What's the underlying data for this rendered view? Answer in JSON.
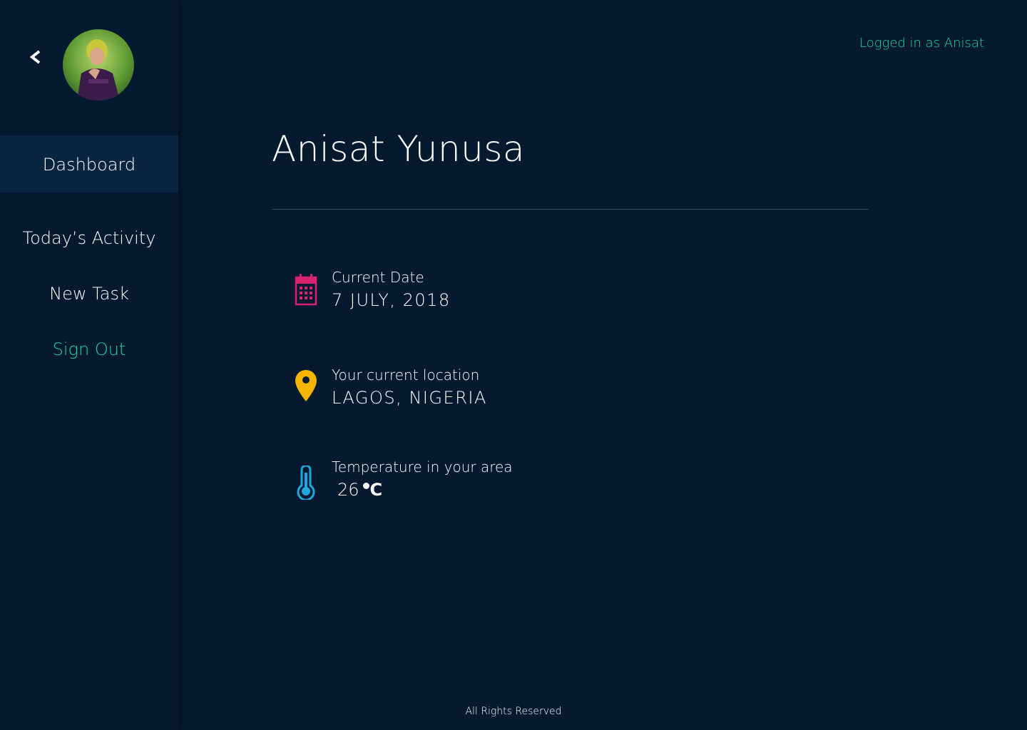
{
  "sidebar": {
    "back_icon": "chevron-left-icon",
    "avatar_alt": "user avatar",
    "items": [
      {
        "label": "Dashboard",
        "active": true
      },
      {
        "label": "Today’s Activity",
        "active": false
      },
      {
        "label": "New Task",
        "active": false
      },
      {
        "label": "Sign Out",
        "active": false
      }
    ]
  },
  "header": {
    "logged_in_text": "Logged in as Anisat"
  },
  "main": {
    "title": "Anisat Yunusa",
    "info": {
      "date": {
        "label": "Current Date",
        "value": "7 JULY, 2018",
        "icon": "calendar-icon",
        "color": "#d8236f"
      },
      "location": {
        "label": "Your current location",
        "value": "LAGOS, NIGERIA",
        "icon": "location-pin-icon",
        "color": "#f5b400"
      },
      "temperature": {
        "label": "Temperature in your area",
        "value": "26",
        "unit": "C",
        "icon": "thermometer-icon",
        "color": "#1ea8e0"
      }
    }
  },
  "footer": {
    "text": "All Rights Reserved"
  },
  "colors": {
    "background": "#061a2f",
    "sidebar_active": "#0a2540",
    "accent": "#1fd6a7"
  }
}
